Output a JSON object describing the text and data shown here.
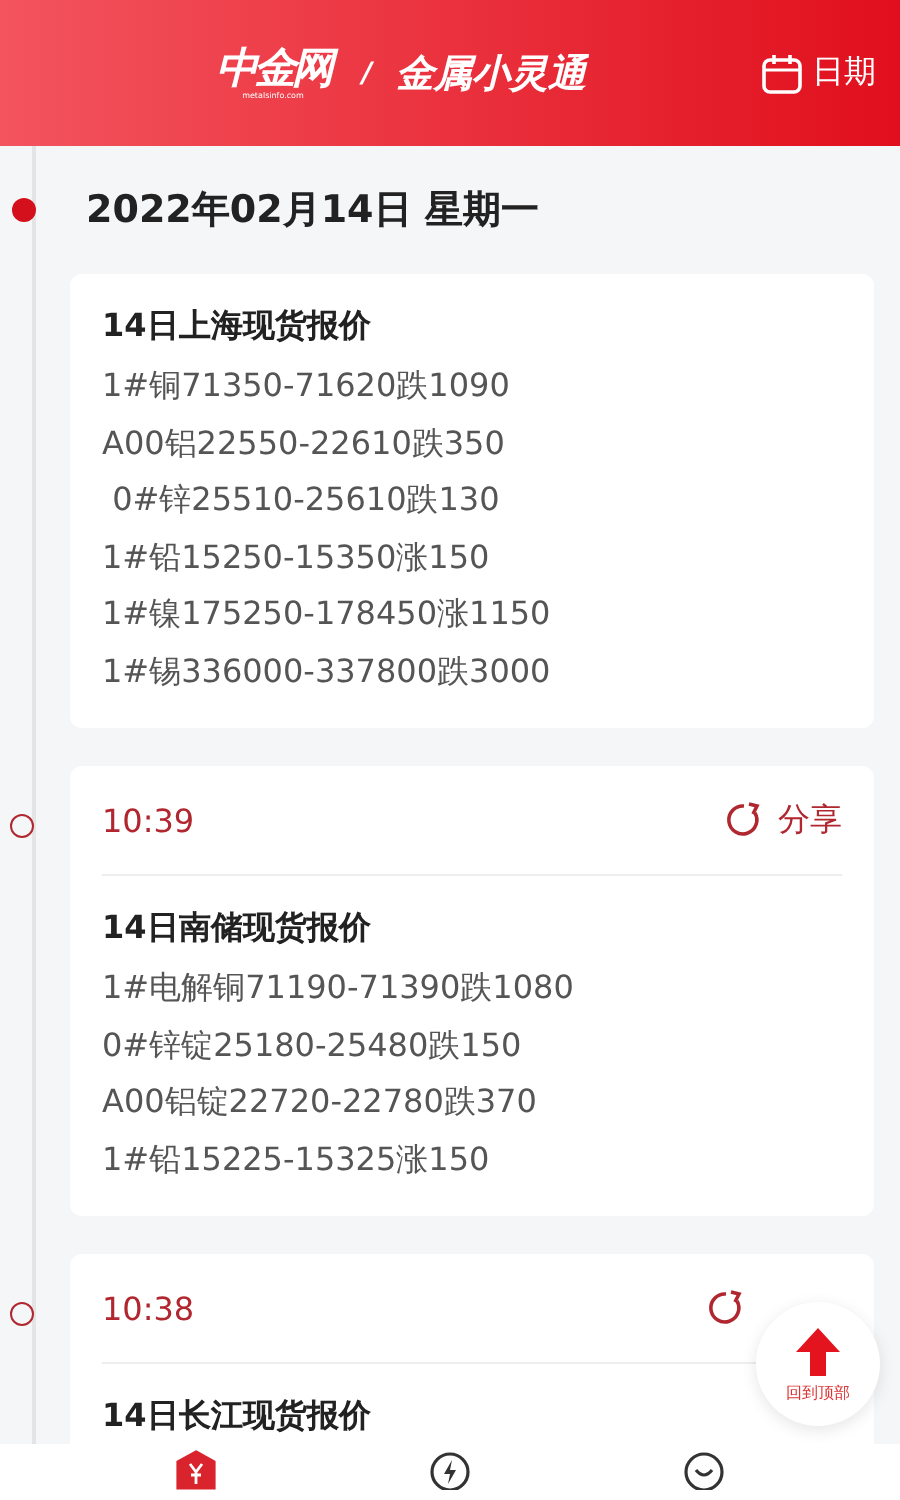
{
  "header": {
    "logo": "中金网",
    "logo_sub": "metalsinfo.com",
    "separator": "/",
    "title": "金属小灵通",
    "date_button": "日期"
  },
  "date_heading": "2022年02月14日 星期一",
  "entries": [
    {
      "title": "14日上海现货报价",
      "lines": [
        "1#铜71350-71620跌1090",
        "A00铝22550-22610跌350",
        " 0#锌25510-25610跌130",
        "1#铅15250-15350涨150",
        "1#镍175250-178450涨1150",
        "1#锡336000-337800跌3000"
      ]
    },
    {
      "time": "10:39",
      "shareable": true,
      "share": "分享",
      "title": "14日南储现货报价",
      "lines": [
        "1#电解铜71190-71390跌1080",
        "0#锌锭25180-25480跌150",
        "A00铝锭22720-22780跌370",
        "1#铅15225-15325涨150"
      ]
    },
    {
      "time": "10:38",
      "shareable": true,
      "title": "14日长江现货报价"
    }
  ],
  "back_to_top": "回到顶部",
  "tabs": [
    {
      "kind": "yuan",
      "selected": true
    },
    {
      "kind": "flash",
      "selected": false
    },
    {
      "kind": "smile",
      "selected": false
    }
  ]
}
